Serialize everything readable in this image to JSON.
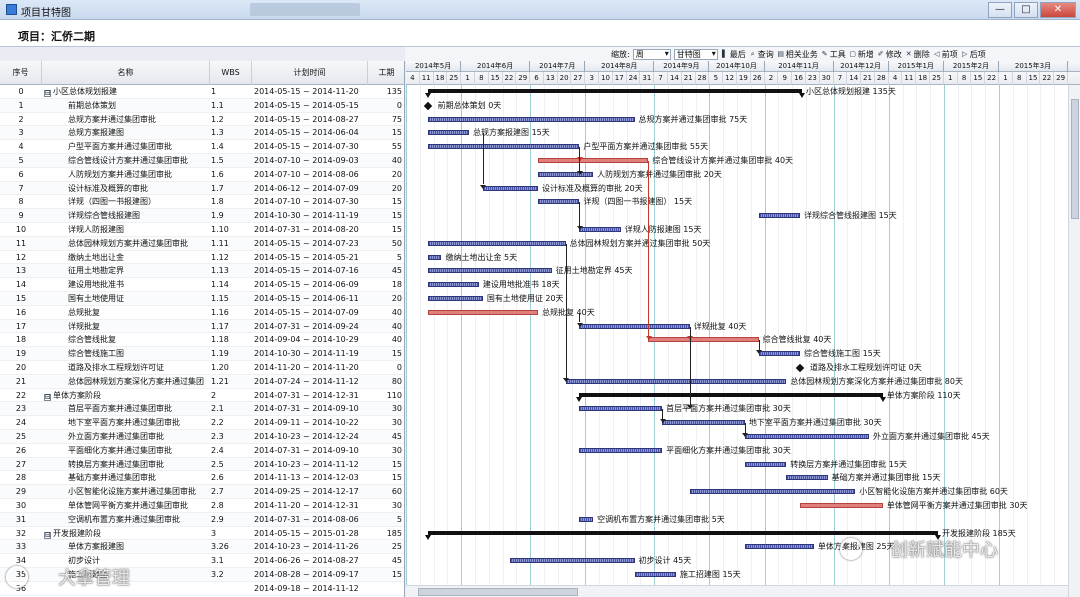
{
  "window": {
    "title": "项目甘特图",
    "buttons": [
      "—",
      "□",
      "✕"
    ]
  },
  "project": {
    "title": "项目：汇侨二期"
  },
  "toolbar": {
    "zoom_label": "缩放:",
    "zoom_value": "周",
    "view_value": "甘特图",
    "items": [
      {
        "icon": "▌",
        "label": "最后",
        "name": "last-button"
      },
      {
        "icon": "⌕",
        "label": "查询",
        "name": "query-button"
      },
      {
        "icon": "▤",
        "label": "相关业务",
        "name": "related-business-button"
      },
      {
        "icon": "✎",
        "label": "工具",
        "name": "tools-button"
      },
      {
        "icon": "▢",
        "label": "新增",
        "name": "add-button"
      },
      {
        "icon": "✐",
        "label": "修改",
        "name": "edit-button"
      },
      {
        "icon": "✕",
        "label": "删除",
        "name": "delete-button"
      },
      {
        "icon": "◁",
        "label": "前项",
        "name": "prev-button"
      },
      {
        "icon": "▷",
        "label": "后项",
        "name": "next-button"
      }
    ]
  },
  "columns": {
    "no": "序号",
    "name": "名称",
    "wbs": "WBS",
    "time": "计划时间",
    "days": "工期"
  },
  "tasks": [
    {
      "no": "0",
      "name": "小区总体规划报建",
      "level": 0,
      "toggle": "⊟",
      "wbs": "1",
      "time": "2014-05-15 ~ 2014-11-20",
      "days": "135"
    },
    {
      "no": "1",
      "name": "前期总体策划",
      "level": 1,
      "wbs": "1.1",
      "time": "2014-05-15 ~ 2014-05-15",
      "days": "0"
    },
    {
      "no": "2",
      "name": "总规方案并通过集团审批",
      "level": 1,
      "wbs": "1.2",
      "time": "2014-05-15 ~ 2014-08-27",
      "days": "75"
    },
    {
      "no": "3",
      "name": "总规方案报建图",
      "level": 1,
      "wbs": "1.3",
      "time": "2014-05-15 ~ 2014-06-04",
      "days": "15"
    },
    {
      "no": "4",
      "name": "户型平面方案并通过集团审批",
      "level": 1,
      "wbs": "1.4",
      "time": "2014-05-15 ~ 2014-07-30",
      "days": "55"
    },
    {
      "no": "5",
      "name": "综合管线设计方案并通过集团审批",
      "level": 1,
      "wbs": "1.5",
      "time": "2014-07-10 ~ 2014-09-03",
      "days": "40"
    },
    {
      "no": "6",
      "name": "人防规划方案并通过集团审批",
      "level": 1,
      "wbs": "1.6",
      "time": "2014-07-10 ~ 2014-08-06",
      "days": "20"
    },
    {
      "no": "7",
      "name": "设计标准及概算的审批",
      "level": 1,
      "wbs": "1.7",
      "time": "2014-06-12 ~ 2014-07-09",
      "days": "20"
    },
    {
      "no": "8",
      "name": "详规（四图一书报建图）",
      "level": 1,
      "wbs": "1.8",
      "time": "2014-07-10 ~ 2014-07-30",
      "days": "15"
    },
    {
      "no": "9",
      "name": "详规综合管线报建图",
      "level": 1,
      "wbs": "1.9",
      "time": "2014-10-30 ~ 2014-11-19",
      "days": "15"
    },
    {
      "no": "10",
      "name": "详规人防报建图",
      "level": 1,
      "wbs": "1.10",
      "time": "2014-07-31 ~ 2014-08-20",
      "days": "15"
    },
    {
      "no": "11",
      "name": "总体园林规划方案并通过集团审批",
      "level": 1,
      "wbs": "1.11",
      "time": "2014-05-15 ~ 2014-07-23",
      "days": "50"
    },
    {
      "no": "12",
      "name": "缴纳土地出让金",
      "level": 1,
      "wbs": "1.12",
      "time": "2014-05-15 ~ 2014-05-21",
      "days": "5"
    },
    {
      "no": "13",
      "name": "征用土地勘定界",
      "level": 1,
      "wbs": "1.13",
      "time": "2014-05-15 ~ 2014-07-16",
      "days": "45"
    },
    {
      "no": "14",
      "name": "建设用地批准书",
      "level": 1,
      "wbs": "1.14",
      "time": "2014-05-15 ~ 2014-06-09",
      "days": "18"
    },
    {
      "no": "15",
      "name": "国有土地使用证",
      "level": 1,
      "wbs": "1.15",
      "time": "2014-05-15 ~ 2014-06-11",
      "days": "20"
    },
    {
      "no": "16",
      "name": "总规批复",
      "level": 1,
      "wbs": "1.16",
      "time": "2014-05-15 ~ 2014-07-09",
      "days": "40"
    },
    {
      "no": "17",
      "name": "详规批复",
      "level": 1,
      "wbs": "1.17",
      "time": "2014-07-31 ~ 2014-09-24",
      "days": "40"
    },
    {
      "no": "18",
      "name": "综合管线批复",
      "level": 1,
      "wbs": "1.18",
      "time": "2014-09-04 ~ 2014-10-29",
      "days": "40"
    },
    {
      "no": "19",
      "name": "综合管线施工图",
      "level": 1,
      "wbs": "1.19",
      "time": "2014-10-30 ~ 2014-11-19",
      "days": "15"
    },
    {
      "no": "20",
      "name": "道路及排水工程规划许可证",
      "level": 1,
      "wbs": "1.20",
      "time": "2014-11-20 ~ 2014-11-20",
      "days": "0"
    },
    {
      "no": "21",
      "name": "总体园林规划方案深化方案并通过集团",
      "level": 1,
      "wbs": "1.21",
      "time": "2014-07-24 ~ 2014-11-12",
      "days": "80"
    },
    {
      "no": "22",
      "name": "单体方案阶段",
      "level": 0,
      "toggle": "⊟",
      "wbs": "2",
      "time": "2014-07-31 ~ 2014-12-31",
      "days": "110"
    },
    {
      "no": "23",
      "name": "首层平面方案并通过集团审批",
      "level": 1,
      "wbs": "2.1",
      "time": "2014-07-31 ~ 2014-09-10",
      "days": "30"
    },
    {
      "no": "24",
      "name": "地下室平面方案并通过集团审批",
      "level": 1,
      "wbs": "2.2",
      "time": "2014-09-11 ~ 2014-10-22",
      "days": "30"
    },
    {
      "no": "25",
      "name": "外立面方案并通过集团审批",
      "level": 1,
      "wbs": "2.3",
      "time": "2014-10-23 ~ 2014-12-24",
      "days": "45"
    },
    {
      "no": "26",
      "name": "平面细化方案并通过集团审批",
      "level": 1,
      "wbs": "2.4",
      "time": "2014-07-31 ~ 2014-09-10",
      "days": "30"
    },
    {
      "no": "27",
      "name": "转换层方案并通过集团审批",
      "level": 1,
      "wbs": "2.5",
      "time": "2014-10-23 ~ 2014-11-12",
      "days": "15"
    },
    {
      "no": "28",
      "name": "基础方案并通过集团审批",
      "level": 1,
      "wbs": "2.6",
      "time": "2014-11-13 ~ 2014-12-03",
      "days": "15"
    },
    {
      "no": "29",
      "name": "小区智能化设施方案并通过集团审批",
      "level": 1,
      "wbs": "2.7",
      "time": "2014-09-25 ~ 2014-12-17",
      "days": "60"
    },
    {
      "no": "30",
      "name": "单体管网平衡方案并通过集团审批",
      "level": 1,
      "wbs": "2.8",
      "time": "2014-11-20 ~ 2014-12-31",
      "days": "30"
    },
    {
      "no": "31",
      "name": "空调机布置方案并通过集团审批",
      "level": 1,
      "wbs": "2.9",
      "time": "2014-07-31 ~ 2014-08-06",
      "days": "5"
    },
    {
      "no": "32",
      "name": "开发报建阶段",
      "level": 0,
      "toggle": "⊟",
      "wbs": "3",
      "time": "2014-05-15 ~ 2015-01-28",
      "days": "185"
    },
    {
      "no": "33",
      "name": "单体方案报建图",
      "level": 1,
      "wbs": "3.26",
      "time": "2014-10-23 ~ 2014-11-26",
      "days": "25"
    },
    {
      "no": "34",
      "name": "初步设计",
      "level": 1,
      "wbs": "3.1",
      "time": "2014-06-26 ~ 2014-08-27",
      "days": "45"
    },
    {
      "no": "35",
      "name": "施工招建图",
      "level": 1,
      "wbs": "3.2",
      "time": "2014-08-28 ~ 2014-09-17",
      "days": "15"
    },
    {
      "no": "36",
      "name": "",
      "level": 1,
      "wbs": "",
      "time": "2014-09-18 ~ 2014-11-12",
      "days": ""
    }
  ],
  "timeline": {
    "months": [
      "2014年5月",
      "2014年6月",
      "2014年7月",
      "2014年8月",
      "2014年9月",
      "2014年10月",
      "2014年11月",
      "2014年12月",
      "2015年1月",
      "2015年2月",
      "2015年3月"
    ],
    "weeks": [
      "4",
      "11",
      "18",
      "25",
      "1",
      "8",
      "15",
      "22",
      "29",
      "6",
      "13",
      "20",
      "27",
      "3",
      "10",
      "17",
      "24",
      "31",
      "7",
      "14",
      "21",
      "28",
      "5",
      "12",
      "19",
      "26",
      "2",
      "9",
      "16",
      "23",
      "30",
      "7",
      "14",
      "21",
      "28",
      "4",
      "11",
      "18",
      "25",
      "1",
      "8",
      "15",
      "22",
      "1",
      "8",
      "15",
      "22",
      "29"
    ]
  },
  "bar_labels": [
    "小区总体规划报建 135天",
    "前期总体策划 0天",
    "总规方案并通过集团审批 75天",
    "总规方案报建图 15天",
    "户型平面方案并通过集团审批 55天",
    "综合管线设计方案并通过集团审批 40天",
    "人防规划方案并通过集团审批 20天",
    "设计标准及概算的审批 20天",
    "详规（四图一书报建图） 15天",
    "详规综合管线报建图 15天",
    "详规人防报建图 15天",
    "总体园林规划方案并通过集团审批 50天",
    "缴纳土地出让金 5天",
    "征用土地勘定界 45天",
    "建设用地批准书 18天",
    "国有土地使用证 20天",
    "总规批复 40天",
    "详规批复 40天",
    "综合管线批复 40天",
    "综合管线施工图 15天",
    "道路及排水工程规划许可证 0天",
    "总体园林规划方案深化方案并通过集团审批 80天",
    "单体方案阶段 110天",
    "首层平面方案并通过集团审批 30天",
    "地下室平面方案并通过集团审批 30天",
    "外立面方案并通过集团审批 45天",
    "平面细化方案并通过集团审批 30天",
    "转换层方案并通过集团审批 15天",
    "基础方案并通过集团审批 15天",
    "小区智能化设施方案并通过集团审批 60天",
    "单体管网平衡方案并通过集团审批 30天",
    "空调机布置方案并通过集团审批 5天",
    "开发报建阶段 185天",
    "单体方案报建图 25天",
    "初步设计 45天",
    "施工招建图 15天",
    ""
  ],
  "critical_tasks": [
    "5",
    "16",
    "18",
    "30"
  ],
  "summary_tasks": [
    "0",
    "22",
    "32"
  ],
  "milestone_tasks": [
    "1",
    "20"
  ],
  "watermarks": {
    "left": "大拿管理",
    "right": "创新赋能中心"
  },
  "colors": {
    "bar": "#4b55a8",
    "critical": "#e07f7b",
    "summary": "#111111",
    "gridline": "#9fd0d8"
  }
}
